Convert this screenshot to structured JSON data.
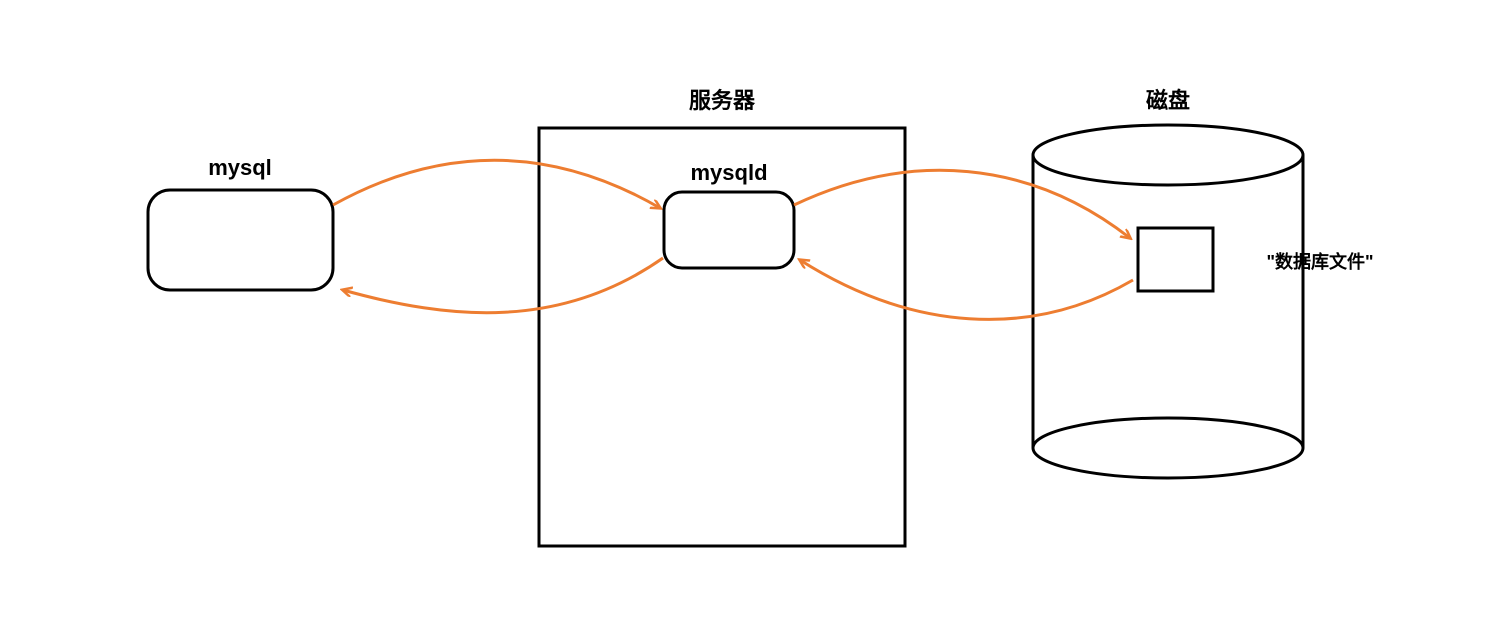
{
  "nodes": {
    "client": {
      "label": "mysql"
    },
    "server_container": {
      "label": "服务器"
    },
    "server_process": {
      "label": "mysqld"
    },
    "disk": {
      "label": "磁盘"
    },
    "db_file": {
      "label": "\"数据库文件\""
    }
  },
  "colors": {
    "stroke": "#000000",
    "arrow": "#ED7D31"
  }
}
